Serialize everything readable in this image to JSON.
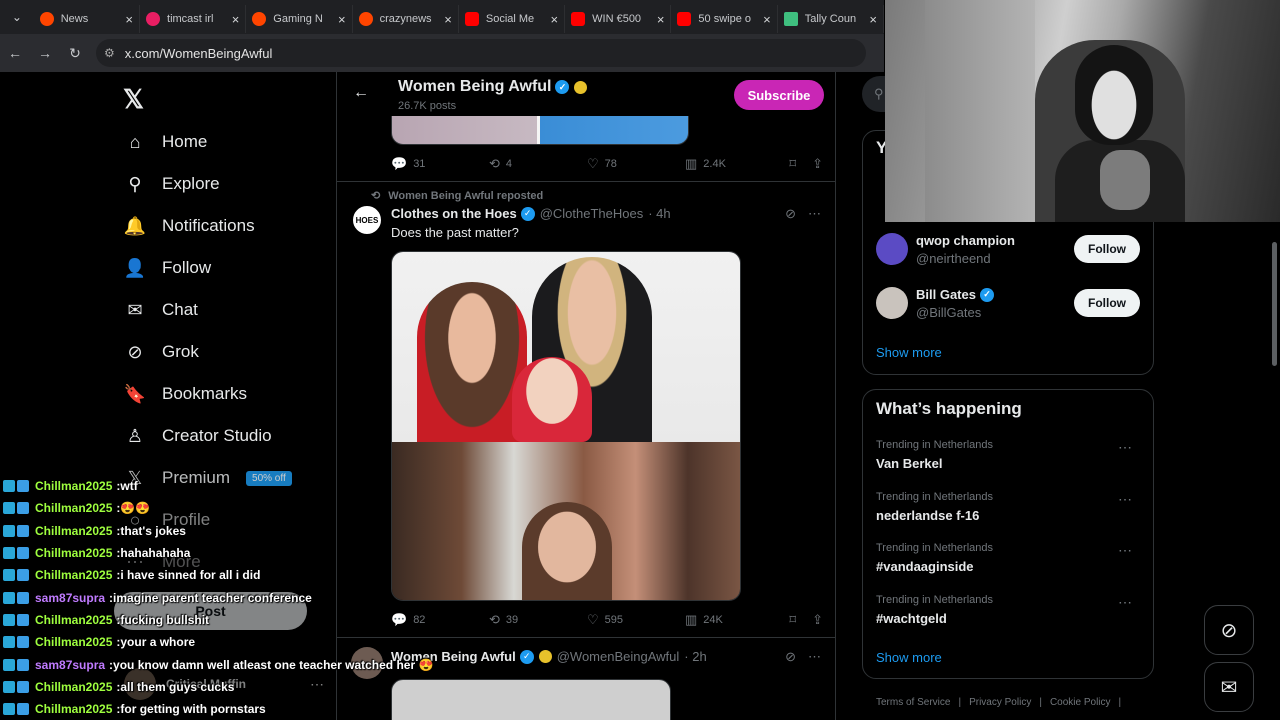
{
  "browser": {
    "tabs": [
      {
        "label": "News",
        "color": "#ff4500"
      },
      {
        "label": "timcast irl",
        "color": "#e91e63"
      },
      {
        "label": "Gaming N",
        "color": "#ff4500"
      },
      {
        "label": "crazynews",
        "color": "#ff4500"
      },
      {
        "label": "Social Me",
        "color": "#ff0000"
      },
      {
        "label": "WIN €500",
        "color": "#ff0000"
      },
      {
        "label": "50 swipe o",
        "color": "#ff0000"
      },
      {
        "label": "Tally Coun",
        "color": "#3fbf7f"
      }
    ],
    "tab_close": "×",
    "url": "x.com/WomenBeingAwful"
  },
  "sidebar": {
    "logo": "𝕏",
    "items": [
      {
        "label": "Home",
        "icon": "⌂"
      },
      {
        "label": "Explore",
        "icon": "⚲"
      },
      {
        "label": "Notifications",
        "icon": "🔔"
      },
      {
        "label": "Follow",
        "icon": "👤"
      },
      {
        "label": "Chat",
        "icon": "✉"
      },
      {
        "label": "Grok",
        "icon": "⊘"
      },
      {
        "label": "Bookmarks",
        "icon": "🔖"
      },
      {
        "label": "Creator Studio",
        "icon": "♙"
      },
      {
        "label": "Premium",
        "icon": "𝕏",
        "badge": "50% off"
      },
      {
        "label": "Profile",
        "icon": "○"
      },
      {
        "label": "More",
        "icon": "⋯"
      }
    ],
    "post_label": "Post",
    "account": {
      "name": "Critical Muffin",
      "more": "⋯"
    }
  },
  "header": {
    "back": "←",
    "title": "Women Being Awful",
    "posts": "26.7K posts",
    "subscribe": "Subscribe"
  },
  "tweet0": {
    "replies": "31",
    "reposts": "4",
    "likes": "78",
    "views": "2.4K"
  },
  "tweet1": {
    "repost_by": "Women Being Awful reposted",
    "avatar_text": "HOES",
    "name": "Clothes on the Hoes",
    "handle": "@ClotheTheHoes",
    "time": "· 4h",
    "text": "Does the past matter?",
    "replies": "82",
    "reposts": "39",
    "likes": "595",
    "views": "24K"
  },
  "tweet2": {
    "name": "Women Being Awful",
    "handle": "@WomenBeingAwful",
    "time": "· 2h"
  },
  "right": {
    "who_title": "Y",
    "suggestions": [
      {
        "name": "qwop champion",
        "handle": "@neirtheend",
        "follow": "Follow",
        "verified": false,
        "avatar_color": "#5b4bc4"
      },
      {
        "name": "Bill Gates",
        "handle": "@BillGates",
        "follow": "Follow",
        "verified": true,
        "avatar_color": "#c9c3bd"
      }
    ],
    "show_more": "Show more",
    "whats_happening": "What’s happening",
    "trends": [
      {
        "context": "Trending in Netherlands",
        "title": "Van Berkel"
      },
      {
        "context": "Trending in Netherlands",
        "title": "nederlandse f-16"
      },
      {
        "context": "Trending in Netherlands",
        "title": "#vandaaginside"
      },
      {
        "context": "Trending in Netherlands",
        "title": "#wachtgeld"
      }
    ],
    "trend_more": "⋯",
    "footer": [
      "Terms of Service",
      "|",
      "Privacy Policy",
      "|",
      "Cookie Policy",
      "|"
    ]
  },
  "chat": [
    {
      "user": "Chillman2025",
      "msg": "wtf",
      "color": "#9fff3f"
    },
    {
      "user": "Chillman2025",
      "msg": "😍😍",
      "color": "#9fff3f"
    },
    {
      "user": "Chillman2025",
      "msg": "that's jokes",
      "color": "#9fff3f"
    },
    {
      "user": "Chillman2025",
      "msg": "hahahahaha",
      "color": "#9fff3f"
    },
    {
      "user": "Chillman2025",
      "msg": "i have sinned for all i did",
      "color": "#9fff3f"
    },
    {
      "user": "sam87supra",
      "msg": "imagine parent teacher conference",
      "color": "#c07bff"
    },
    {
      "user": "Chillman2025",
      "msg": "fucking bullshit",
      "color": "#9fff3f"
    },
    {
      "user": "Chillman2025",
      "msg": "your a whore",
      "color": "#9fff3f"
    },
    {
      "user": "sam87supra",
      "msg": "you know damn well atleast one teacher watched her 😍",
      "color": "#c07bff"
    },
    {
      "user": "Chillman2025",
      "msg": "all them guys cucks",
      "color": "#9fff3f"
    },
    {
      "user": "Chillman2025",
      "msg": "for getting with pornstars",
      "color": "#9fff3f"
    }
  ],
  "chat_sep": " : "
}
